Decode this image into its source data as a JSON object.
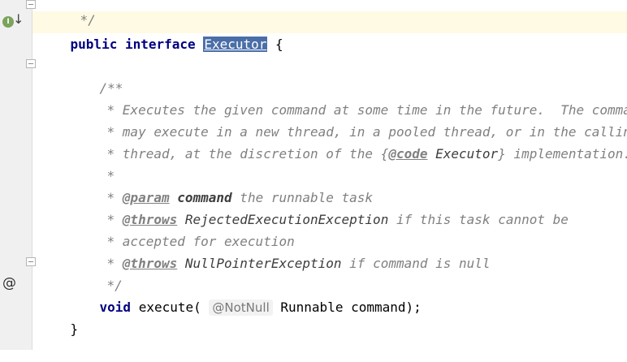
{
  "editor": {
    "top_fragment": "*/",
    "line_decl": {
      "kw_public": "public",
      "kw_interface": "interface",
      "name": "Executor",
      "brace": "{"
    },
    "javadoc": {
      "open": "/**",
      "l1": "* Executes the given command at some time in the future.  The command",
      "l2": "* may execute in a new thread, in a pooled thread, or in the calling",
      "l3_pre": "* thread, at the discretion of the {",
      "l3_tag": "@code",
      "l3_ref": " Executor",
      "l3_post": "} implementation.",
      "l4": "*",
      "l5_star": "* ",
      "l5_tag": "@param",
      "l5_name": "command",
      "l5_text": " the runnable task",
      "l6_star": "* ",
      "l6_tag": "@throws",
      "l6_ref": " RejectedExecutionException",
      "l6_text": " if this task cannot be",
      "l7": "* accepted for execution",
      "l8_star": "* ",
      "l8_tag": "@throws",
      "l8_ref": " NullPointerException",
      "l8_text": " if command is null",
      "close": "*/"
    },
    "method": {
      "kw_void": "void",
      "sig_pre": " execute(",
      "hint": "@NotNull",
      "sig_post": "Runnable command);"
    },
    "closing_brace": "}"
  },
  "gutter": {
    "impl_icon_letter": "I",
    "impl_arrow": "↓",
    "override_icon": "@"
  }
}
